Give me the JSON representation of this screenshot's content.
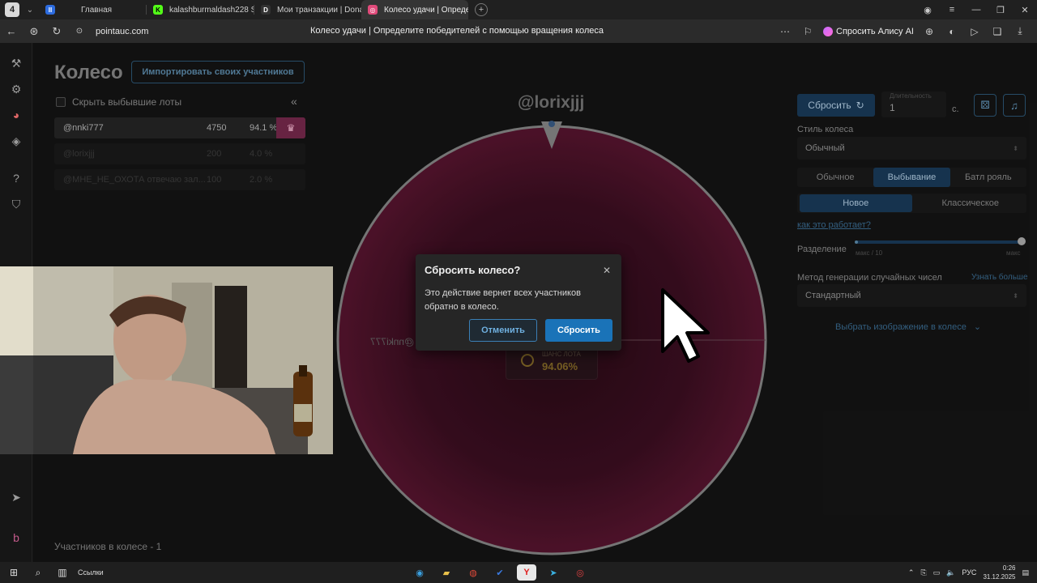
{
  "browser": {
    "tab_count": "4",
    "tabs": [
      {
        "label": "Главная",
        "fav_color": "#2d6cdf",
        "fav_glyph": "II"
      },
      {
        "label": "kalashburmaldash228 Stre",
        "fav_color": "#53fc18",
        "fav_glyph": "K"
      },
      {
        "label": "Мои транзакции | Donate",
        "fav_color": "#333333",
        "fav_glyph": "D"
      },
      {
        "label": "Колесо удачи | Определ",
        "fav_color": "#e04a7a",
        "fav_glyph": "◎"
      }
    ],
    "url": "pointauc.com",
    "page_title": "Колесо удачи | Определите победителей с помощью вращения колеса",
    "alice_label": "Спросить Алису AI"
  },
  "left": {
    "title": "Колесо",
    "import_button": "Импортировать своих участников",
    "hide_label": "Скрыть выбывшие лоты",
    "lots": [
      {
        "name": "@nnki777",
        "amount": "4750",
        "percent": "94.1 %"
      },
      {
        "name": "@lorixjjj",
        "amount": "200",
        "percent": "4.0 %"
      },
      {
        "name": "@МНЕ_НЕ_ОХОТА отвечаю зал...",
        "amount": "100",
        "percent": "2.0 %"
      }
    ],
    "participants_count": "Участников в колесе - 1"
  },
  "wheel": {
    "top_name": "@lorixjjj",
    "mirror_name": "@nnki777",
    "chance_label": "ШАНС ЛОТА",
    "chance_value": "94.06%",
    "fill_color": "#5a1530",
    "rim_color": "#8a8a8a"
  },
  "right": {
    "reset_button": "Сбросить",
    "duration_label": "Длительность",
    "duration_value": "1",
    "seconds_suffix": "с.",
    "style_label": "Стиль колеса",
    "style_value": "Обычный",
    "modes": [
      "Обычное",
      "Выбывание",
      "Батл рояль"
    ],
    "active_mode": 1,
    "variants": [
      "Новое",
      "Классическое"
    ],
    "active_variant": 0,
    "how_link": "как это работает?",
    "split_label": "Разделение",
    "split_min": "макс / 10",
    "split_max": "макс",
    "rng_label": "Метод генерации случайных чисел",
    "rng_link": "Узнать больше",
    "rng_value": "Стандартный",
    "image_picker": "Выбрать изображение в колесе"
  },
  "modal": {
    "title": "Сбросить колесо?",
    "body": "Это действие вернет всех участников обратно в колесо.",
    "cancel": "Отменить",
    "confirm": "Сбросить"
  },
  "taskbar": {
    "links_label": "Ссылки",
    "lang": "РУС",
    "time": "0:26",
    "date": "31.12.2025"
  },
  "accent": "#1a73b8"
}
